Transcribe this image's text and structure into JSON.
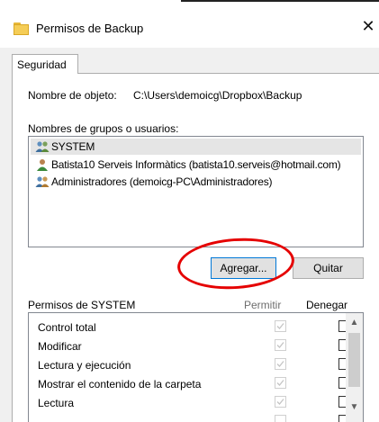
{
  "window": {
    "title": "Permisos de Backup",
    "close_glyph": "✕"
  },
  "tabs": [
    {
      "label": "Seguridad"
    }
  ],
  "object": {
    "label": "Nombre de objeto:",
    "value": "C:\\Users\\demoicg\\Dropbox\\Backup"
  },
  "groups": {
    "label": "Nombres de grupos o usuarios:",
    "items": [
      {
        "name": "SYSTEM",
        "icon": "users-group-icon",
        "selected": true
      },
      {
        "name": "Batista10 Serveis Informàtics (batista10.serveis@hotmail.com)",
        "icon": "user-icon",
        "selected": false
      },
      {
        "name": "Administradores (demoicg-PC\\Administradores)",
        "icon": "users-group-icon",
        "selected": false
      }
    ]
  },
  "buttons": {
    "add": "Agregar...",
    "remove": "Quitar"
  },
  "permissions": {
    "label": "Permisos de SYSTEM",
    "allow_header": "Permitir",
    "deny_header": "Denegar",
    "rows": [
      {
        "name": "Control total",
        "allow": true,
        "deny": false
      },
      {
        "name": "Modificar",
        "allow": true,
        "deny": false
      },
      {
        "name": "Lectura y ejecución",
        "allow": true,
        "deny": false
      },
      {
        "name": "Mostrar el contenido de la carpeta",
        "allow": true,
        "deny": false
      },
      {
        "name": "Lectura",
        "allow": true,
        "deny": false
      }
    ]
  },
  "colors": {
    "annotation_ellipse": "#e50000",
    "selection": "#e5e5e5",
    "focus_border": "#0078d7"
  }
}
